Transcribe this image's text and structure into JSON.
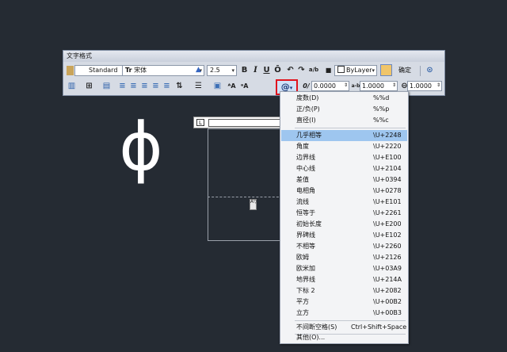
{
  "canvas": {
    "background": "#252b33"
  },
  "glyph": {
    "symbol": "ϕ"
  },
  "toolbar": {
    "title": "文字格式",
    "style_value": "Standard",
    "font_value": "宋体",
    "font_prefix": "Tr",
    "height_value": "2.5",
    "bold": "B",
    "italic": "I",
    "underline": "U",
    "overline": "Ō",
    "undo": "↶",
    "redo": "↷",
    "stack": "a/b",
    "color_value": "ByLayer",
    "ok_label": "确定",
    "symbol_button": "@",
    "oblique_icon": "0/",
    "oblique_value": "0.0000",
    "tracking_icon": "a-b",
    "tracking_value": "1.0000",
    "width_icon": "⊖",
    "width_value": "1.0000",
    "highlight_color": "#e0141e"
  },
  "ruler": {
    "tab_label": "L"
  },
  "editor": {
    "handle_label": "A▽"
  },
  "menu": {
    "items_top": [
      {
        "label": "度数(D)",
        "code": "%%d"
      },
      {
        "label": "正/负(P)",
        "code": "%%p"
      },
      {
        "label": "直径(I)",
        "code": "%%c"
      }
    ],
    "items_mid": [
      {
        "label": "几乎相等",
        "code": "\\U+2248"
      },
      {
        "label": "角度",
        "code": "\\U+2220"
      },
      {
        "label": "边界线",
        "code": "\\U+E100"
      },
      {
        "label": "中心线",
        "code": "\\U+2104"
      },
      {
        "label": "差值",
        "code": "\\U+0394"
      },
      {
        "label": "电相角",
        "code": "\\U+0278"
      },
      {
        "label": "流线",
        "code": "\\U+E101"
      },
      {
        "label": "恒等于",
        "code": "\\U+2261"
      },
      {
        "label": "初始长度",
        "code": "\\U+E200"
      },
      {
        "label": "界碑线",
        "code": "\\U+E102"
      },
      {
        "label": "不相等",
        "code": "\\U+2260"
      },
      {
        "label": "欧姆",
        "code": "\\U+2126"
      },
      {
        "label": "欧米加",
        "code": "\\U+03A9"
      },
      {
        "label": "地界线",
        "code": "\\U+214A"
      },
      {
        "label": "下标 2",
        "code": "\\U+2082"
      },
      {
        "label": "平方",
        "code": "\\U+00B2"
      },
      {
        "label": "立方",
        "code": "\\U+00B3"
      }
    ],
    "nbsp": {
      "label": "不间断空格(S)",
      "code": "Ctrl+Shift+Space"
    },
    "other": {
      "label": "其他(O)..."
    },
    "highlight_color": "#9ec6ef"
  }
}
